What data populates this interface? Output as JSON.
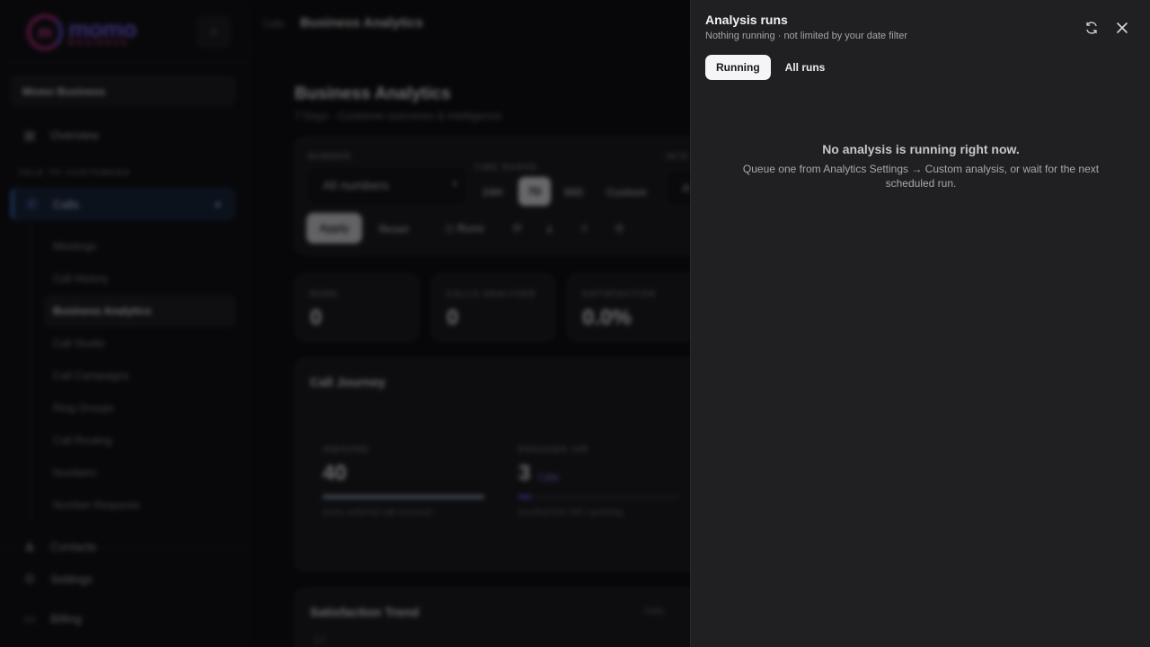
{
  "sidebar": {
    "logo": {
      "name": "momo",
      "tagline": "business"
    },
    "org": "Momo Business",
    "overview": "Overview",
    "section_label": "TALK TO CUSTOMERS",
    "calls": "Calls",
    "sub_items": [
      "Meetings",
      "Call History",
      "Business Analytics",
      "Call Studio",
      "Call Campaigns",
      "Ring Groups",
      "Call Routing",
      "Numbers",
      "Number Requests"
    ],
    "contacts": "Contacts",
    "settings": "Settings",
    "billing": "Billing"
  },
  "breadcrumb": {
    "parent": "Calls",
    "current": "Business Analytics"
  },
  "page": {
    "title": "Business Analytics",
    "subtitle": "7 Days · Customer outcomes & intelligence"
  },
  "filters": {
    "number_label": "NUMBER",
    "number_value": "All numbers",
    "time_label": "TIME RANGE",
    "ranges": [
      "24H",
      "7D",
      "30D",
      "Custom"
    ],
    "selected_range": "7D",
    "intent_label": "INTE",
    "intent_value": "A",
    "apply": "Apply",
    "reset": "Reset",
    "runs": "Runs"
  },
  "stats": [
    {
      "label": "RUNS",
      "value": "0"
    },
    {
      "label": "CALLS ANALYZED",
      "value": "0"
    },
    {
      "label": "SATISFACTION",
      "value": "0.0%"
    }
  ],
  "journey": {
    "title": "Call Journey",
    "stages": [
      {
        "label": "INBOUND",
        "value": "40",
        "pct": "",
        "desc": "every external call received",
        "fill": 1.0
      },
      {
        "label": "ENGAGED IVR",
        "value": "3",
        "pct": "7.5%",
        "desc": "touched the IVR / greeting",
        "fill": 0.075
      }
    ]
  },
  "trend": {
    "title": "Satisfaction Trend",
    "toggle": "Daily",
    "tick": "1.0"
  },
  "drawer": {
    "title": "Analysis runs",
    "subtitle": "Nothing running · not limited by your date filter",
    "tabs": [
      "Running",
      "All runs"
    ],
    "active_tab": "Running",
    "empty_title": "No analysis is running right now.",
    "empty_desc": "Queue one from Analytics Settings → Custom analysis, or wait for the next scheduled run."
  },
  "colors": {
    "accent_blue": "#3f7ed8",
    "ivr_purple": "#5a4fe0",
    "drawer_bg": "#202023"
  }
}
